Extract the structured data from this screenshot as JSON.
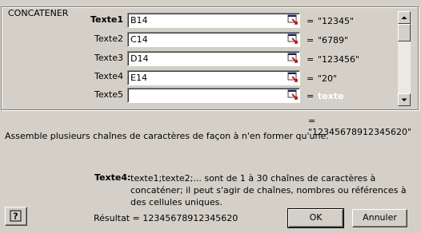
{
  "dialog": {
    "group_title": "CONCATENER",
    "args": [
      {
        "label": "Texte1",
        "value": "B14",
        "result": "\"12345\"",
        "active": true
      },
      {
        "label": "Texte2",
        "value": "C14",
        "result": "\"6789\"",
        "active": false
      },
      {
        "label": "Texte3",
        "value": "D14",
        "result": "\"123456\"",
        "active": false
      },
      {
        "label": "Texte4",
        "value": "E14",
        "result": "\"20\"",
        "active": false
      },
      {
        "label": "Texte5",
        "value": "",
        "result": "texte",
        "active": false
      }
    ],
    "equals_sign": "=",
    "function_result": "= \"12345678912345620\"",
    "description": "Assemble plusieurs chaînes de caractères de façon à n'en former qu'une.",
    "help_arg_name": "Texte4:",
    "help_arg_text": "texte1;texte2;... sont de 1 à 30 chaînes de caractères à concaténer; il peut s'agir de chaînes, nombres ou références à des cellules uniques.",
    "formula_result": "Résultat = 12345678912345620",
    "ok_label": "OK",
    "cancel_label": "Annuler",
    "help_icon": "question-mark-icon",
    "collapse_icon": "collapse-dialog-icon"
  }
}
